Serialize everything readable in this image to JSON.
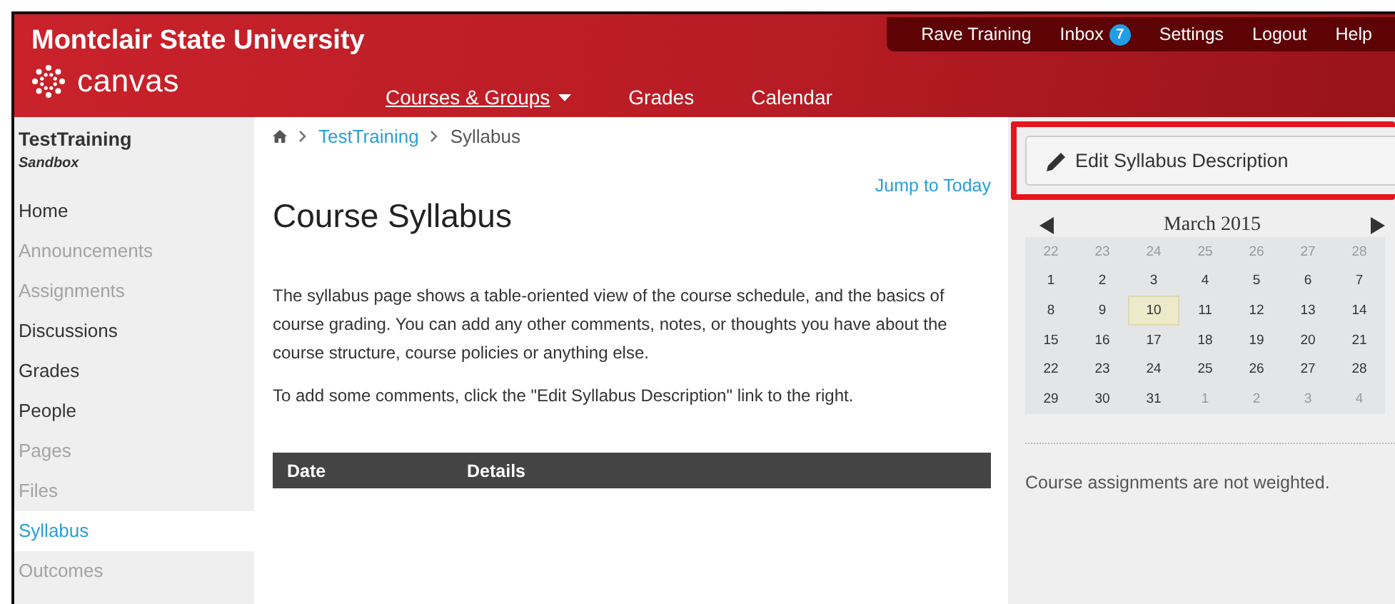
{
  "header": {
    "institution": "Montclair State University",
    "logo_text": "canvas",
    "user_nav": [
      {
        "label": "Rave Training"
      },
      {
        "label": "Inbox",
        "badge": "7"
      },
      {
        "label": "Settings"
      },
      {
        "label": "Logout"
      },
      {
        "label": "Help"
      }
    ],
    "main_nav": [
      {
        "label": "Courses & Groups",
        "dropdown": true,
        "selected": true
      },
      {
        "label": "Grades",
        "dropdown": false,
        "selected": false
      },
      {
        "label": "Calendar",
        "dropdown": false,
        "selected": false
      }
    ]
  },
  "sidebar": {
    "course": "TestTraining",
    "subtitle": "Sandbox",
    "items": [
      {
        "label": "Home",
        "disabled": false,
        "selected": false
      },
      {
        "label": "Announcements",
        "disabled": true,
        "selected": false
      },
      {
        "label": "Assignments",
        "disabled": true,
        "selected": false
      },
      {
        "label": "Discussions",
        "disabled": false,
        "selected": false
      },
      {
        "label": "Grades",
        "disabled": false,
        "selected": false
      },
      {
        "label": "People",
        "disabled": false,
        "selected": false
      },
      {
        "label": "Pages",
        "disabled": true,
        "selected": false
      },
      {
        "label": "Files",
        "disabled": true,
        "selected": false
      },
      {
        "label": "Syllabus",
        "disabled": false,
        "selected": true
      },
      {
        "label": "Outcomes",
        "disabled": true,
        "selected": false
      }
    ]
  },
  "breadcrumb": [
    {
      "label": "TestTraining",
      "link": true
    },
    {
      "label": "Syllabus",
      "link": false
    }
  ],
  "jump_link": "Jump to Today",
  "title": "Course Syllabus",
  "paragraphs": [
    "The syllabus page shows a table-oriented view of the course schedule, and the basics of course grading. You can add any other comments, notes, or thoughts you have about the course structure, course policies or anything else.",
    "To add some comments, click the \"Edit Syllabus Description\" link to the right."
  ],
  "table": {
    "columns": [
      "Date",
      "Details"
    ]
  },
  "edit_button": "Edit Syllabus Description",
  "calendar": {
    "month": "March 2015",
    "weeks": [
      [
        {
          "day": "22",
          "outside": true,
          "today": false
        },
        {
          "day": "23",
          "outside": true,
          "today": false
        },
        {
          "day": "24",
          "outside": true,
          "today": false
        },
        {
          "day": "25",
          "outside": true,
          "today": false
        },
        {
          "day": "26",
          "outside": true,
          "today": false
        },
        {
          "day": "27",
          "outside": true,
          "today": false
        },
        {
          "day": "28",
          "outside": true,
          "today": false
        }
      ],
      [
        {
          "day": "1",
          "outside": false,
          "today": false
        },
        {
          "day": "2",
          "outside": false,
          "today": false
        },
        {
          "day": "3",
          "outside": false,
          "today": false
        },
        {
          "day": "4",
          "outside": false,
          "today": false
        },
        {
          "day": "5",
          "outside": false,
          "today": false
        },
        {
          "day": "6",
          "outside": false,
          "today": false
        },
        {
          "day": "7",
          "outside": false,
          "today": false
        }
      ],
      [
        {
          "day": "8",
          "outside": false,
          "today": false
        },
        {
          "day": "9",
          "outside": false,
          "today": false
        },
        {
          "day": "10",
          "outside": false,
          "today": true
        },
        {
          "day": "11",
          "outside": false,
          "today": false
        },
        {
          "day": "12",
          "outside": false,
          "today": false
        },
        {
          "day": "13",
          "outside": false,
          "today": false
        },
        {
          "day": "14",
          "outside": false,
          "today": false
        }
      ],
      [
        {
          "day": "15",
          "outside": false,
          "today": false
        },
        {
          "day": "16",
          "outside": false,
          "today": false
        },
        {
          "day": "17",
          "outside": false,
          "today": false
        },
        {
          "day": "18",
          "outside": false,
          "today": false
        },
        {
          "day": "19",
          "outside": false,
          "today": false
        },
        {
          "day": "20",
          "outside": false,
          "today": false
        },
        {
          "day": "21",
          "outside": false,
          "today": false
        }
      ],
      [
        {
          "day": "22",
          "outside": false,
          "today": false
        },
        {
          "day": "23",
          "outside": false,
          "today": false
        },
        {
          "day": "24",
          "outside": false,
          "today": false
        },
        {
          "day": "25",
          "outside": false,
          "today": false
        },
        {
          "day": "26",
          "outside": false,
          "today": false
        },
        {
          "day": "27",
          "outside": false,
          "today": false
        },
        {
          "day": "28",
          "outside": false,
          "today": false
        }
      ],
      [
        {
          "day": "29",
          "outside": false,
          "today": false
        },
        {
          "day": "30",
          "outside": false,
          "today": false
        },
        {
          "day": "31",
          "outside": false,
          "today": false
        },
        {
          "day": "1",
          "outside": true,
          "today": false
        },
        {
          "day": "2",
          "outside": true,
          "today": false
        },
        {
          "day": "3",
          "outside": true,
          "today": false
        },
        {
          "day": "4",
          "outside": true,
          "today": false
        }
      ]
    ]
  },
  "weighting_note": "Course assignments are not weighted."
}
